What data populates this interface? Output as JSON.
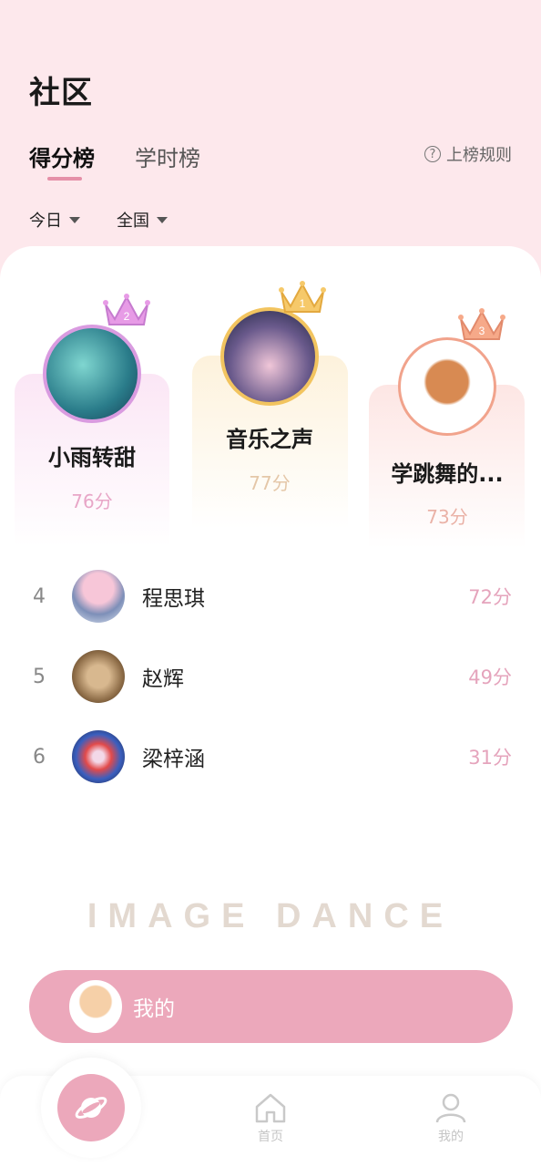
{
  "header": {
    "title": "社区"
  },
  "tabs": [
    {
      "label": "得分榜",
      "active": true
    },
    {
      "label": "学时榜",
      "active": false
    }
  ],
  "rules": {
    "label": "上榜规则",
    "icon": "question-circle-icon"
  },
  "filters": [
    {
      "label": "今日"
    },
    {
      "label": "全国"
    }
  ],
  "podium": [
    {
      "rank": "2",
      "name": "小雨转甜",
      "score": "76分",
      "crown": "pink"
    },
    {
      "rank": "1",
      "name": "音乐之声",
      "score": "77分",
      "crown": "gold"
    },
    {
      "rank": "3",
      "name": "学跳舞的...",
      "score": "73分",
      "crown": "peach"
    }
  ],
  "list": [
    {
      "rank": "4",
      "name": "程思琪",
      "score": "72分"
    },
    {
      "rank": "5",
      "name": "赵辉",
      "score": "49分"
    },
    {
      "rank": "6",
      "name": "梁梓涵",
      "score": "31分"
    }
  ],
  "brand": "IMAGE DANCE",
  "mine": {
    "label": "我的"
  },
  "nav": [
    {
      "label": "首页",
      "icon": "home-icon"
    },
    {
      "label": "我的",
      "icon": "user-icon"
    }
  ],
  "colors": {
    "accent": "#eca8bb",
    "score": "#e5a4bc",
    "background": "#fde8ec"
  }
}
